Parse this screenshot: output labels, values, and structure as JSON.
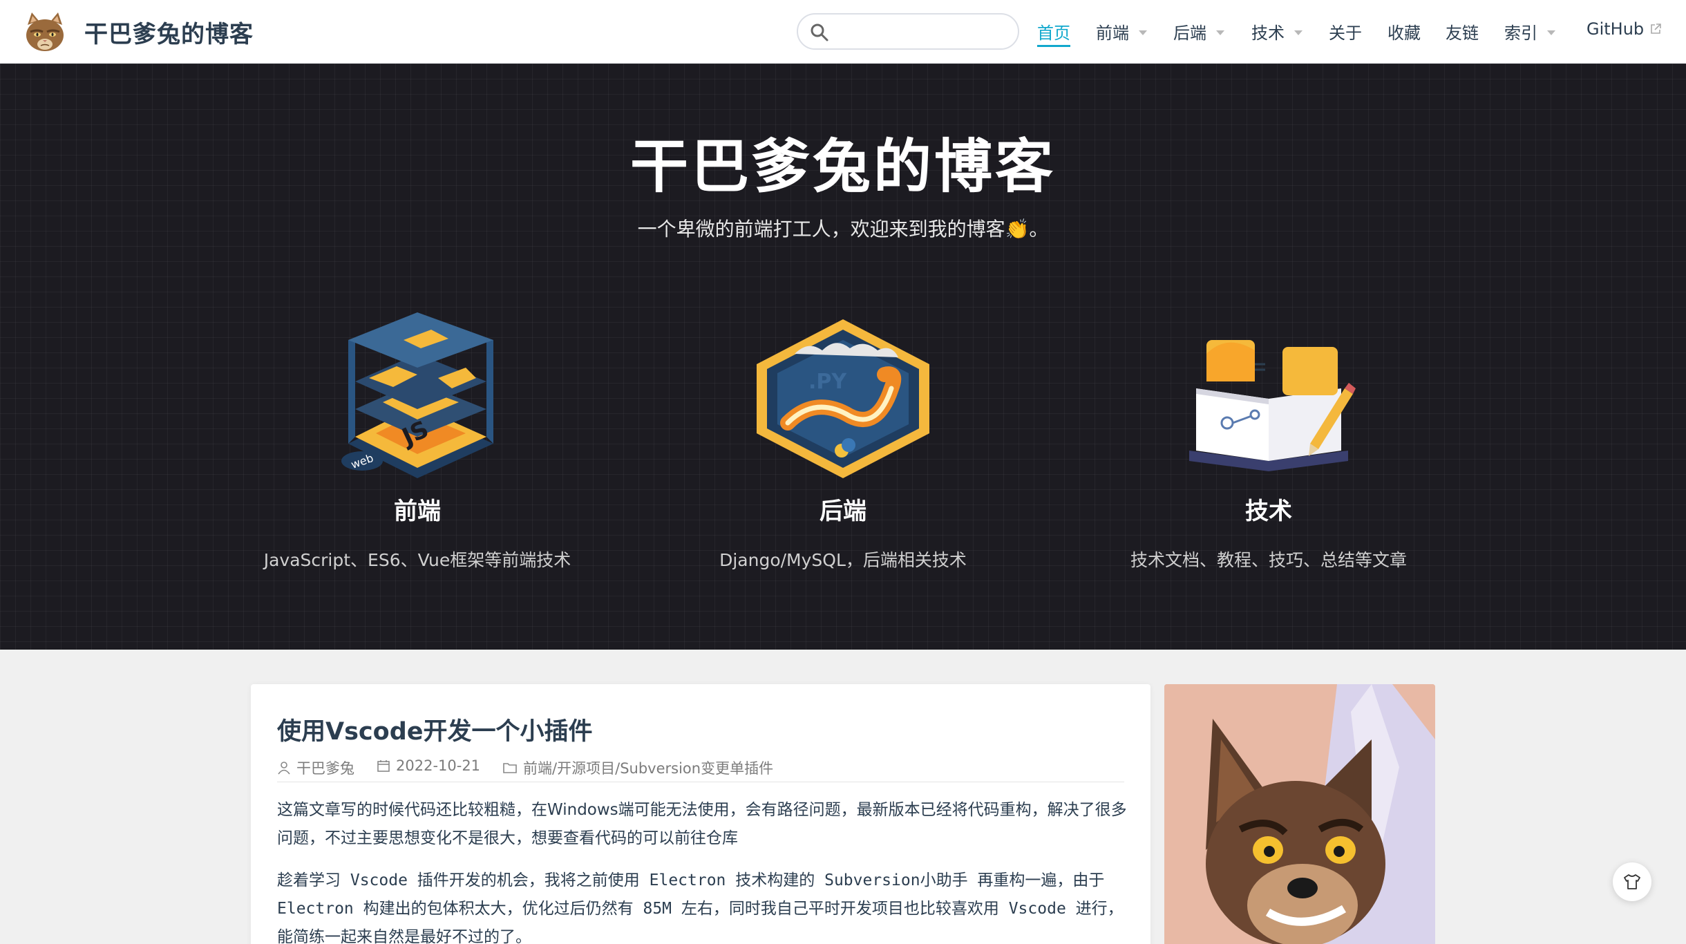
{
  "navbar": {
    "site_name": "干巴爹兔的博客",
    "search": {
      "value": "",
      "placeholder": ""
    },
    "items": [
      {
        "label": "首页",
        "active": true,
        "dropdown": false
      },
      {
        "label": "前端",
        "active": false,
        "dropdown": true
      },
      {
        "label": "后端",
        "active": false,
        "dropdown": true
      },
      {
        "label": "技术",
        "active": false,
        "dropdown": true
      },
      {
        "label": "关于",
        "active": false,
        "dropdown": false
      },
      {
        "label": "收藏",
        "active": false,
        "dropdown": false
      },
      {
        "label": "友链",
        "active": false,
        "dropdown": false
      },
      {
        "label": "索引",
        "active": false,
        "dropdown": true
      },
      {
        "label": "GitHub",
        "active": false,
        "dropdown": false,
        "external": true
      }
    ],
    "accent_color": "#11a8cd"
  },
  "hero": {
    "title": "干巴爹兔的博客",
    "description": "一个卑微的前端打工人，欢迎来到我的博客👏。",
    "features": [
      {
        "title": "前端",
        "description": "JavaScript、ES6、Vue框架等前端技术",
        "icon": "javascript-web-stack-icon",
        "icon_text": "JS",
        "icon_subtext": "web"
      },
      {
        "title": "后端",
        "description": "Django/MySQL，后端相关技术",
        "icon": "python-snake-icon",
        "icon_text": ".PY"
      },
      {
        "title": "技术",
        "description": "技术文档、教程、技巧、总结等文章",
        "icon": "open-book-pencil-icon"
      }
    ]
  },
  "post": {
    "title": "使用Vscode开发一个小插件",
    "author": "干巴爹兔",
    "date": "2022-10-21",
    "categories": "前端/开源项目/Subversion变更单插件",
    "paragraphs": [
      "这篇文章写的时候代码还比较粗糙，在Windows端可能无法使用，会有路径问题，最新版本已经将代码重构，解决了很多问题，不过主要思想变化不是很大，想要查看代码的可以前往仓库",
      "趁着学习 Vscode 插件开发的机会，我将之前使用 Electron 技术构建的 Subversion小助手 再重构一遍，由于 Electron 构建出的包体积太大，优化过后仍然有 85M 左右，同时我自己平时开发项目也比较喜欢用 Vscode 进行，能简练一起来自然是最好不过的了。"
    ]
  },
  "sidebar": {
    "avatar": "wolf-avatar-illustration"
  },
  "float_button": {
    "icon": "shirt-icon"
  }
}
